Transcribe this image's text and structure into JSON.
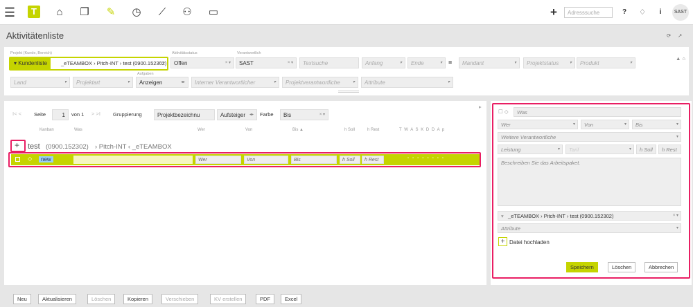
{
  "topbar": {
    "search_placeholder": "Adresssuche",
    "help": "?",
    "bell": "♢",
    "info": "i",
    "avatar": "SAST",
    "plus": "+",
    "logo": "T"
  },
  "page": {
    "title": "Aktivitätenliste"
  },
  "filters": {
    "label_projekt": "Projekt (Kunde, Bereich)",
    "kundenliste": "Kundenliste",
    "projekt_value": "_eTEAMBOX › Pitch-INT › test (0900.152302)",
    "label_status": "Aktivitätsstatus",
    "status": "Offen",
    "label_verantwortlich": "Verantwortlich",
    "verantwortlich": "SAST",
    "textsuche": "Textsuche",
    "anfang": "Anfang",
    "ende": "Ende",
    "mandant": "Mandant",
    "projektstatus": "Projektstatus",
    "produkt": "Produkt",
    "land": "Land",
    "projektart": "Projektart",
    "label_aufgaben": "Aufgaben",
    "aufgaben": "Anzeigen",
    "interner": "Interner Verantwortlicher",
    "projektverantwortliche": "Projektverantwortliche",
    "attribute": "Attribute"
  },
  "list": {
    "seite": "Seite",
    "page_num": "1",
    "von": "von 1",
    "gruppierung": "Gruppierung",
    "gruppierung_value": "Projektbezeichnu",
    "sort": "Aufsteiger",
    "farbe": "Farbe",
    "farbe_value": "Bis",
    "headers": {
      "kanban": "Kanban",
      "was": "Was",
      "wer": "Wer",
      "von": "Von",
      "bis": "Bis ▲",
      "hsoll": "h Soll",
      "hrest": "h Rest",
      "days": "T W A S K D D A p"
    },
    "group_title": "test",
    "group_code": "(0900.152302)",
    "group_path": "› Pitch-INT ‹ _eTEAMBOX",
    "row": {
      "badge": "new",
      "wer": "Wer",
      "von": "Von",
      "bis": "Bis",
      "hsoll": "h Soll",
      "hrest": "h Rest"
    }
  },
  "side": {
    "was": "Was",
    "wer": "Wer",
    "von": "Von",
    "bis": "Bis",
    "weitere": "Weitere Verantwortliche",
    "leistung": "Leistung",
    "tarif": "Tarif",
    "hsoll": "h Soll",
    "hrest": "h Rest",
    "beschreibung": "Beschreiben Sie das Arbeitspaket.",
    "project": "_eTEAMBOX › Pitch-INT › test (0900.152302)",
    "attribute": "Attribute",
    "upload": "Datei hochladen",
    "save": "Speichern",
    "delete": "Löschen",
    "cancel": "Abbrechen"
  },
  "bottom": {
    "neu": "Neu",
    "aktualisieren": "Aktualisieren",
    "loeschen": "Löschen",
    "kopieren": "Kopieren",
    "verschieben": "Verschieben",
    "kv": "KV erstellen",
    "pdf": "PDF",
    "excel": "Excel"
  },
  "colors": {
    "accent": "#c5d400",
    "highlight": "#e91e63"
  }
}
